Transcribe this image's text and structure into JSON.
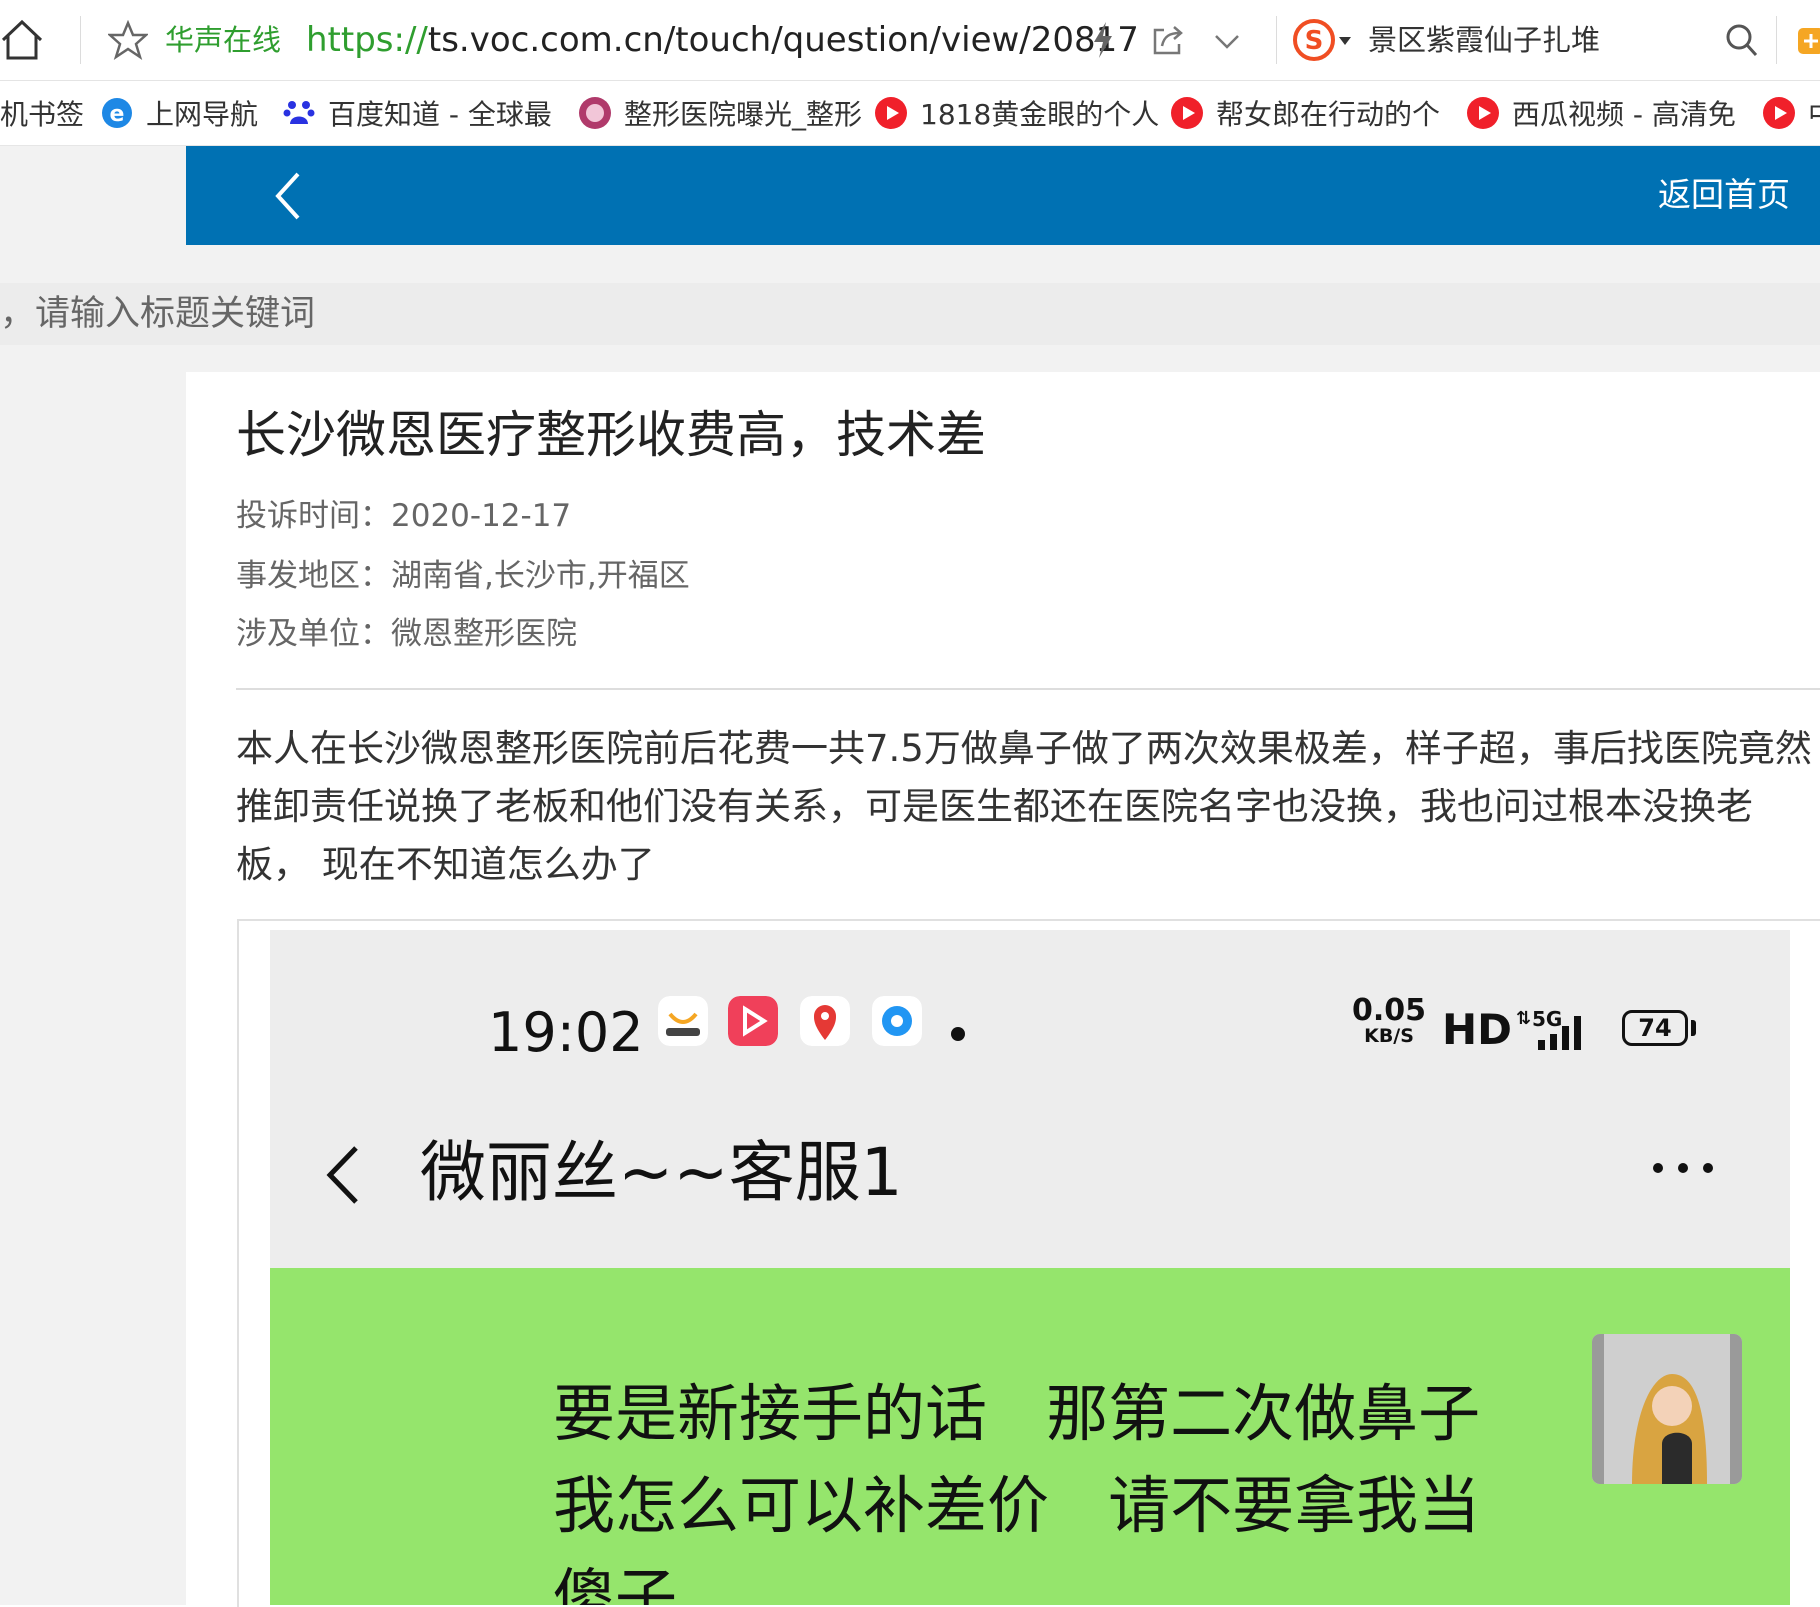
{
  "browser": {
    "site_name": "华声在线",
    "url_scheme": "https://",
    "url_rest": "ts.voc.com.cn/touch/question/view/20817",
    "search_text": "景区紫霞仙子扎堆"
  },
  "bookmarks": [
    {
      "label": "机书签",
      "icon": "bookmark-folder-icon"
    },
    {
      "label": "上网导航",
      "icon": "ie-icon"
    },
    {
      "label": "百度知道 - 全球最",
      "icon": "baidu-icon"
    },
    {
      "label": "整形医院曝光_整形",
      "icon": "site-logo-icon"
    },
    {
      "label": "1818黄金眼的个人",
      "icon": "play-icon"
    },
    {
      "label": "帮女郎在行动的个",
      "icon": "play-icon"
    },
    {
      "label": "西瓜视频 - 高清免",
      "icon": "play-icon"
    },
    {
      "label": "中",
      "icon": "play-icon"
    }
  ],
  "nav": {
    "home_link": "返回首页"
  },
  "search": {
    "placeholder": "，请输入标题关键词"
  },
  "complaint": {
    "title": "长沙微恩医疗整形收费高，技术差",
    "time_label": "投诉时间：",
    "time_value": "2020-12-17",
    "location_label": "事发地区：",
    "location_value": "湖南省,长沙市,开福区",
    "unit_label": "涉及单位：",
    "unit_value": "微恩整形医院",
    "body": "本人在长沙微恩整形医院前后花费一共7.5万做鼻子做了两次效果极差，样子超，事后找医院竟然推卸责任说换了老板和他们没有关系，可是医生都还在医院名字也没换，我也问过根本没换老板， 现在不知道怎么办了"
  },
  "screenshot": {
    "time": "19:02",
    "net_speed": "0.05",
    "net_unit": "KB/S",
    "hd": "HD",
    "network": "5G",
    "battery": "74",
    "chat_title": "微丽丝~~客服1",
    "message": "要是新接手的话   那第二次做鼻子\n我怎么可以补差价   请不要拿我当\n傻子",
    "colors": {
      "chat_bubble": "#95e56c",
      "topbar": "#0071b3"
    }
  }
}
